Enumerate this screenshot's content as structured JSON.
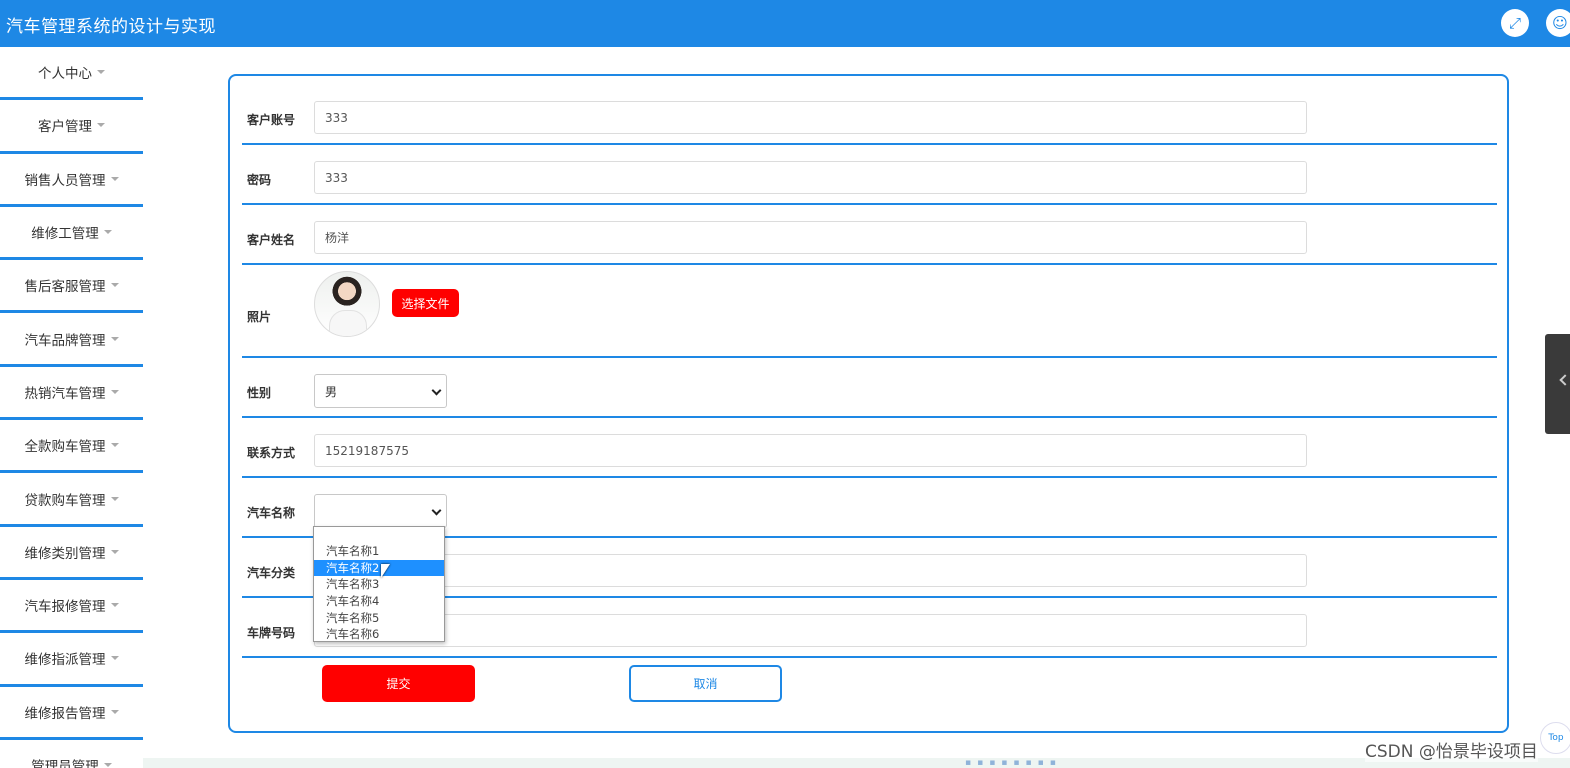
{
  "header": {
    "title": "汽车管理系统的设计与实现",
    "fullscreen_icon": "expand-icon",
    "user_icon": "user-icon"
  },
  "sidebar": {
    "items": [
      {
        "label": "个人中心"
      },
      {
        "label": "客户管理"
      },
      {
        "label": "销售人员管理"
      },
      {
        "label": "维修工管理"
      },
      {
        "label": "售后客服管理"
      },
      {
        "label": "汽车品牌管理"
      },
      {
        "label": "热销汽车管理"
      },
      {
        "label": "全款购车管理"
      },
      {
        "label": "贷款购车管理"
      },
      {
        "label": "维修类别管理"
      },
      {
        "label": "汽车报修管理"
      },
      {
        "label": "维修指派管理"
      },
      {
        "label": "维修报告管理"
      },
      {
        "label": "管理员管理"
      }
    ]
  },
  "form": {
    "account": {
      "label": "客户账号",
      "value": "333"
    },
    "password": {
      "label": "密码",
      "value": "333"
    },
    "name": {
      "label": "客户姓名",
      "value": "杨洋"
    },
    "photo": {
      "label": "照片",
      "button": "选择文件"
    },
    "gender": {
      "label": "性别",
      "value": "男"
    },
    "phone": {
      "label": "联系方式",
      "value": "15219187575"
    },
    "car_name": {
      "label": "汽车名称",
      "value": ""
    },
    "car_category": {
      "label": "汽车分类",
      "value": ""
    },
    "plate": {
      "label": "车牌号码",
      "value": ""
    },
    "submit": "提交",
    "cancel": "取消"
  },
  "dropdown": {
    "options": [
      "汽车名称1",
      "汽车名称2",
      "汽车名称3",
      "汽车名称4",
      "汽车名称5",
      "汽车名称6"
    ],
    "highlighted": "汽车名称2"
  },
  "misc": {
    "top_button": "Top",
    "watermark": "CSDN @怡景毕设项目"
  },
  "colors": {
    "primary": "#1e88e5",
    "danger": "#ff0000"
  }
}
